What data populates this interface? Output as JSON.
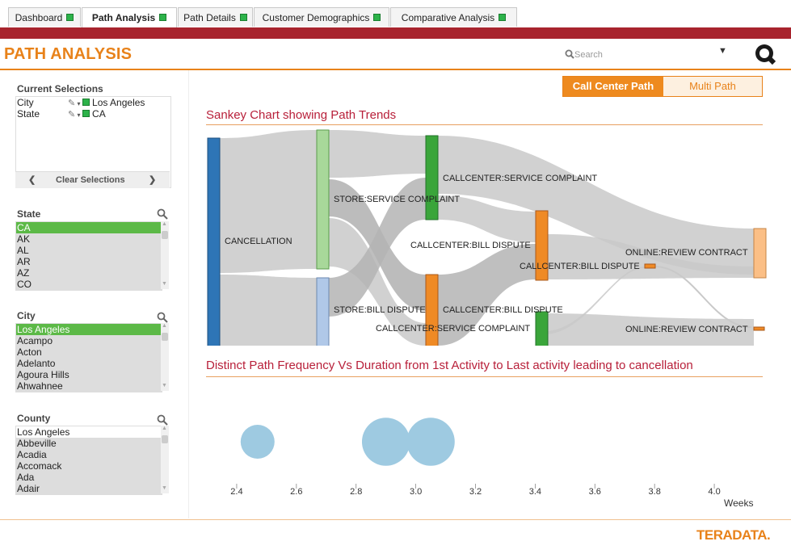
{
  "tabs": [
    {
      "label": "Dashboard",
      "active": false
    },
    {
      "label": "Path Analysis",
      "active": true
    },
    {
      "label": "Path Details",
      "active": false
    },
    {
      "label": "Customer Demographics",
      "active": false
    },
    {
      "label": "Comparative Analysis",
      "active": false
    }
  ],
  "header": {
    "title": "PATH ANALYSIS",
    "search_placeholder": "Search"
  },
  "left": {
    "current_selections": {
      "title": "Current Selections",
      "rows": [
        {
          "field": "City",
          "value": "Los Angeles"
        },
        {
          "field": "State",
          "value": "CA"
        }
      ],
      "clear_label": "Clear Selections"
    },
    "state": {
      "title": "State",
      "items": [
        "CA",
        "AK",
        "AL",
        "AR",
        "AZ",
        "CO"
      ],
      "selected": "CA"
    },
    "city": {
      "title": "City",
      "items": [
        "Los Angeles",
        "Acampo",
        "Acton",
        "Adelanto",
        "Agoura Hills",
        "Ahwahnee"
      ],
      "selected": "Los Angeles"
    },
    "county": {
      "title": "County",
      "items": [
        "Los Angeles",
        "Abbeville",
        "Acadia",
        "Accomack",
        "Ada",
        "Adair"
      ],
      "selected": ""
    }
  },
  "toggle": {
    "on_label": "Call Center Path",
    "off_label": "Multi Path"
  },
  "sankey": {
    "title": "Sankey Chart showing Path Trends",
    "node_labels": {
      "cancellation": "CANCELLATION",
      "store_service": "STORE:SERVICE COMPLAINT",
      "store_bill": "STORE:BILL DISPUTE",
      "cc_service_top": "CALLCENTER:SERVICE COMPLAINT",
      "cc_bill_mid": "CALLCENTER:BILL DISPUTE",
      "cc_bill_right": "CALLCENTER:BILL DISPUTE",
      "cc_bill_low": "CALLCENTER:BILL DISPUTE",
      "cc_service_low": "CALLCENTER:SERVICE COMPLAINT",
      "online_review_1": "ONLINE:REVIEW CONTRACT",
      "online_review_2": "ONLINE:REVIEW CONTRACT",
      "online_review_3": "ONLINE:REVIEW CONTRACT"
    },
    "colors": {
      "blue": "#2e75b6",
      "lightgreen": "#a8d89a",
      "lightblue": "#b0c8e8",
      "green": "#3aa53a",
      "orange": "#ef8a25",
      "lightorange": "#fbbf86",
      "link": "#c8c8c8"
    }
  },
  "chart_data": {
    "type": "scatter",
    "title": "Distinct Path Frequency Vs Duration from 1st Activity to Last activity leading to cancellation",
    "xlabel": "Weeks",
    "xlim": [
      2.3,
      4.1
    ],
    "ticks": [
      2.4,
      2.6,
      2.8,
      3.0,
      3.2,
      3.4,
      3.6,
      3.8,
      4.0
    ],
    "tick_labels": [
      "2.4",
      "2.6",
      "2.8",
      "3.0",
      "3.2",
      "3.4",
      "3.6",
      "3.8",
      "4.0"
    ],
    "bubble_color": "#9ecae1",
    "points": [
      {
        "x": 2.47,
        "size": 1
      },
      {
        "x": 2.9,
        "size": 2
      },
      {
        "x": 3.05,
        "size": 2
      }
    ]
  },
  "footer": {
    "logo": "TERADATA."
  }
}
